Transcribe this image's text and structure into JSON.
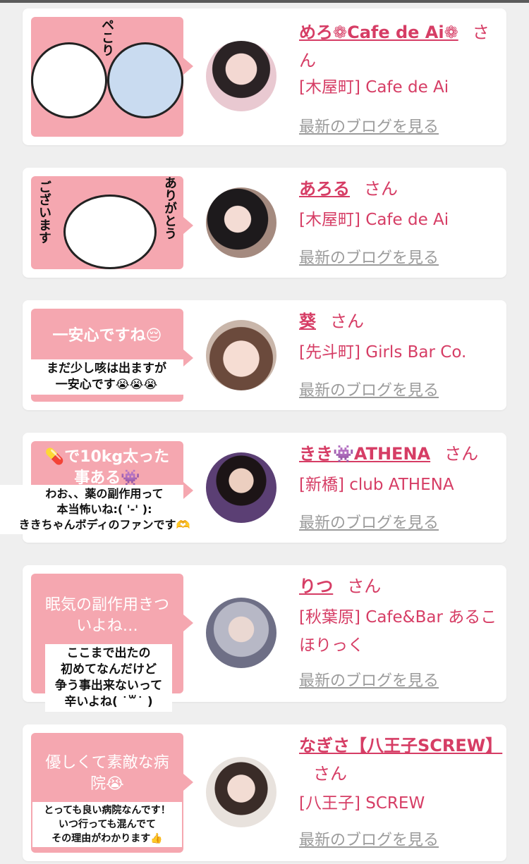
{
  "suffix": "さん",
  "blog_link": "最新のブログを見る",
  "cards": [
    {
      "sticker_text": "ペこり",
      "name": "めろ❁Cafe de Ai❁",
      "area": "[木屋町]",
      "shop": "Cafe de Ai"
    },
    {
      "sticker_text_left": "ございます",
      "sticker_text_right": "ありがとう",
      "name": "あろる",
      "area": "[木屋町]",
      "shop": "Cafe de Ai"
    },
    {
      "bubble_title": "一安心ですね😔",
      "bubble_sub": "まだ少し咳は出ますが\n一安心です😭😭😭",
      "name": "葵",
      "area": "[先斗町]",
      "shop": "Girls Bar Co."
    },
    {
      "bubble_title": "💊で10kg太った\n事ある👾",
      "bubble_sub": "わお、、薬の副作用って\n本当怖いね:( '-' ):\nききちゃんボディのファンです🫶",
      "name": "きき👾ATHENA",
      "area": "[新橋]",
      "shop": "club ATHENA"
    },
    {
      "bubble_title": "眠気の副作用きつ\nいよね…",
      "bubble_sub": "ここまで出たの\n初めてなんだけど\n争う事出来ないって\n辛いよね( ˙꒳˙ )",
      "name": "りつ",
      "area": "[秋葉原]",
      "shop": "Cafe&Bar あるこほりっく"
    },
    {
      "bubble_title": "優しくて素敵な病\n院😭",
      "bubble_sub": "とっても良い病院なんです！\nいつ行っても混んでて\nその理由がわかります👍",
      "name": "なぎさ【八王子SCREW】",
      "area": "[八王子]",
      "shop": "SCREW"
    }
  ]
}
